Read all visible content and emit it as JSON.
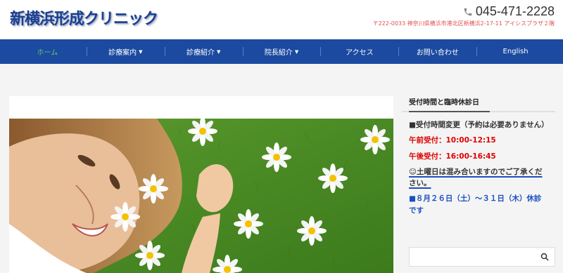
{
  "header": {
    "logo_text": "新横浜形成クリニック",
    "phone": "045-471-2228",
    "address": "〒222-0033 神奈川県横浜市港北区新横浜2-17-11 アイシスプラザ２階"
  },
  "nav": {
    "items": [
      {
        "label": "ホーム",
        "dropdown": false
      },
      {
        "label": "診療案内",
        "dropdown": true
      },
      {
        "label": "診療紹介",
        "dropdown": true
      },
      {
        "label": "院長紹介",
        "dropdown": true
      },
      {
        "label": "アクセス",
        "dropdown": false
      },
      {
        "label": "お問い合わせ",
        "dropdown": false
      },
      {
        "label": "English",
        "dropdown": false
      }
    ],
    "chevron": "▼"
  },
  "sidebar": {
    "title": "受付時間と臨時休診日",
    "line1": "■受付時間変更（予約は必要ありません）",
    "line2": "午前受付：10:00-12:15",
    "line3": "午後受付：16:00-16:45",
    "line4": "☺土曜日は混み合いますのでご了承ください。",
    "line5": "■８月２６日（土）～３１日（木）休診です"
  },
  "search": {
    "placeholder": ""
  },
  "colors": {
    "nav_bg": "#1b4aa0",
    "active_nav": "#6ac36a",
    "logo": "#1c3f8e",
    "address": "#e35050",
    "red": "#e10000",
    "blue": "#1a4ec2"
  }
}
